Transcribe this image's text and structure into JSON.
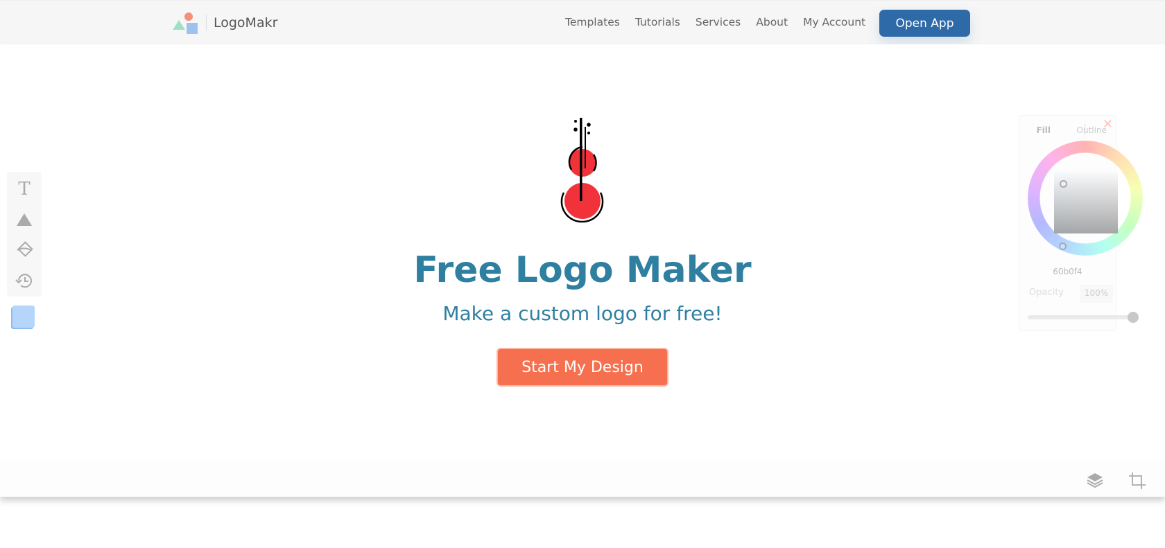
{
  "header": {
    "brand": "LogoMakr",
    "nav": [
      "Templates",
      "Tutorials",
      "Services",
      "About",
      "My Account"
    ],
    "open_app": "Open App"
  },
  "hero": {
    "title": "Free Logo Maker",
    "subtitle": "Make a custom logo for free!",
    "cta": "Start My Design",
    "logo_color": "#f2323a"
  },
  "toolbar": {
    "items": [
      "text-icon",
      "shape-icon",
      "fill-icon",
      "history-icon"
    ],
    "swatch_color": "#b5d6fa"
  },
  "color_panel": {
    "tabs": [
      "Fill",
      "Outline"
    ],
    "active_tab": "Fill",
    "hex": "60b0f4",
    "opacity_label": "Opacity",
    "opacity_value": "100%",
    "opacity": 100
  },
  "bottom": {
    "icons": [
      "layers-icon",
      "crop-icon"
    ]
  }
}
